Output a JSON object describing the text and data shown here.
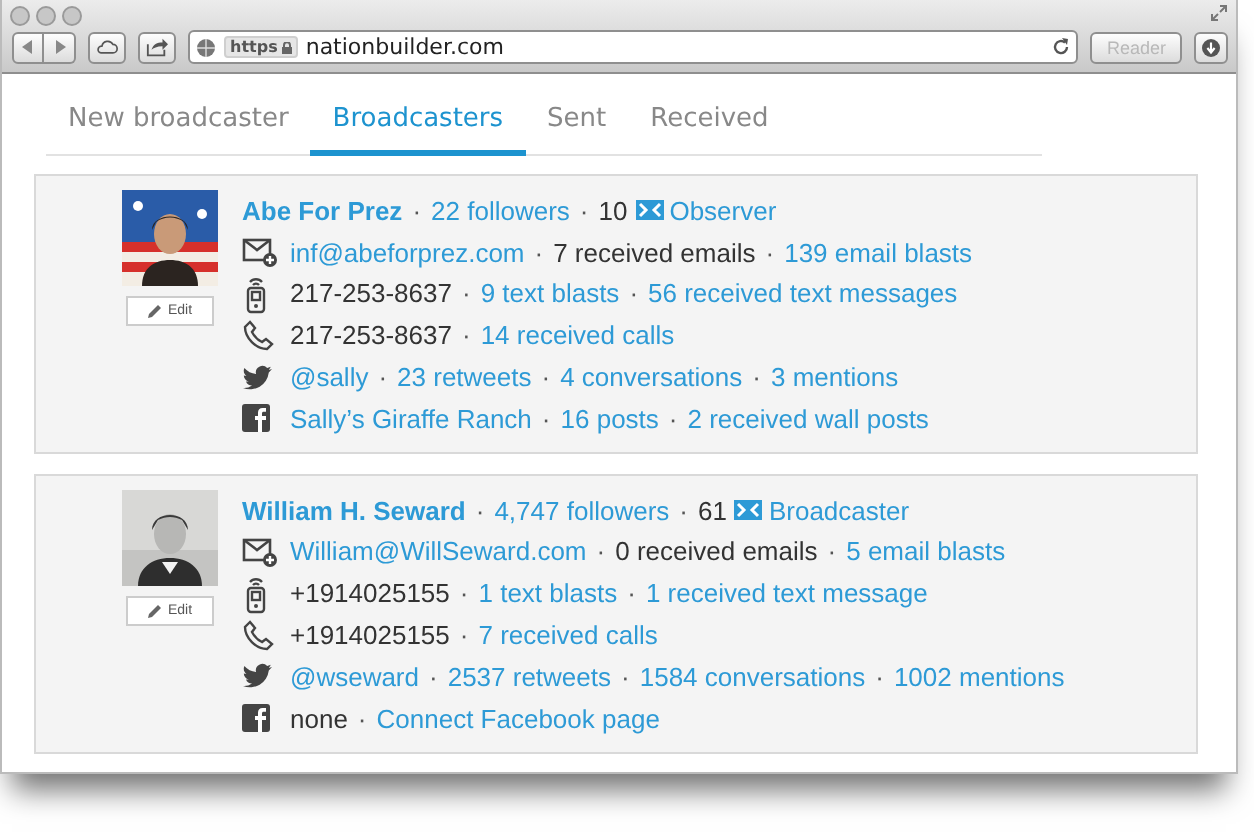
{
  "browser": {
    "scheme": "https",
    "url": "nationbuilder.com",
    "reader": {
      "label": "Reader",
      "disabled": true
    }
  },
  "tabs": [
    {
      "label": "New broadcaster",
      "selected": false
    },
    {
      "label": "Broadcasters",
      "selected": true
    },
    {
      "label": "Sent",
      "selected": false
    },
    {
      "label": "Received",
      "selected": false
    }
  ],
  "broadcasters": [
    {
      "edit_button": "Edit",
      "separator": "·",
      "lines": [
        {
          "kind": "header",
          "groups": [
            [
              {
                "kind": "name",
                "text": "Abe For Prez"
              }
            ],
            [
              {
                "kind": "link",
                "text": "22 followers"
              }
            ],
            [
              {
                "kind": "plain",
                "text": "10"
              },
              {
                "kind": "role",
                "text": "Observer"
              }
            ]
          ]
        },
        {
          "kind": "email",
          "groups": [
            [
              {
                "kind": "link",
                "text": "inf@abeforprez.com"
              }
            ],
            [
              {
                "kind": "plain",
                "text": "7 received emails"
              }
            ],
            [
              {
                "kind": "link",
                "text": "139 email blasts"
              }
            ]
          ]
        },
        {
          "kind": "mobile",
          "groups": [
            [
              {
                "kind": "plain",
                "text": "217-253-8637"
              }
            ],
            [
              {
                "kind": "link",
                "text": "9 text blasts"
              }
            ],
            [
              {
                "kind": "link",
                "text": "56 received text messages"
              }
            ]
          ]
        },
        {
          "kind": "phone",
          "groups": [
            [
              {
                "kind": "plain",
                "text": "217-253-8637"
              }
            ],
            [
              {
                "kind": "link",
                "text": "14 received calls"
              }
            ]
          ]
        },
        {
          "kind": "twitter",
          "groups": [
            [
              {
                "kind": "link",
                "text": "@sally"
              }
            ],
            [
              {
                "kind": "link",
                "text": "23 retweets"
              }
            ],
            [
              {
                "kind": "link",
                "text": "4 conversations"
              }
            ],
            [
              {
                "kind": "link",
                "text": "3 mentions"
              }
            ]
          ]
        },
        {
          "kind": "facebook",
          "groups": [
            [
              {
                "kind": "link",
                "text": "Sally’s Giraffe Ranch"
              }
            ],
            [
              {
                "kind": "link",
                "text": "16 posts"
              }
            ],
            [
              {
                "kind": "link",
                "text": "2 received wall posts"
              }
            ]
          ]
        }
      ]
    },
    {
      "edit_button": "Edit",
      "separator": "·",
      "lines": [
        {
          "kind": "header",
          "groups": [
            [
              {
                "kind": "name",
                "text": "William H. Seward"
              }
            ],
            [
              {
                "kind": "link",
                "text": "4,747 followers"
              }
            ],
            [
              {
                "kind": "plain",
                "text": "61"
              },
              {
                "kind": "role",
                "text": "Broadcaster"
              }
            ]
          ]
        },
        {
          "kind": "email",
          "groups": [
            [
              {
                "kind": "link",
                "text": "William@WillSeward.com"
              }
            ],
            [
              {
                "kind": "plain",
                "text": "0 received emails"
              }
            ],
            [
              {
                "kind": "link",
                "text": "5 email blasts"
              }
            ]
          ]
        },
        {
          "kind": "mobile",
          "groups": [
            [
              {
                "kind": "plain",
                "text": "+1914025155"
              }
            ],
            [
              {
                "kind": "link",
                "text": "1 text blasts"
              }
            ],
            [
              {
                "kind": "link",
                "text": "1 received text message"
              }
            ]
          ]
        },
        {
          "kind": "phone",
          "groups": [
            [
              {
                "kind": "plain",
                "text": "+1914025155"
              }
            ],
            [
              {
                "kind": "link",
                "text": "7 received calls"
              }
            ]
          ]
        },
        {
          "kind": "twitter",
          "groups": [
            [
              {
                "kind": "link",
                "text": "@wseward"
              }
            ],
            [
              {
                "kind": "link",
                "text": "2537 retweets"
              }
            ],
            [
              {
                "kind": "link",
                "text": "1584 conversations"
              }
            ],
            [
              {
                "kind": "link",
                "text": "1002 mentions"
              }
            ]
          ]
        },
        {
          "kind": "facebook",
          "groups": [
            [
              {
                "kind": "plain",
                "text": "none"
              }
            ],
            [
              {
                "kind": "link",
                "text": "Connect Facebook page"
              }
            ]
          ]
        }
      ]
    }
  ]
}
